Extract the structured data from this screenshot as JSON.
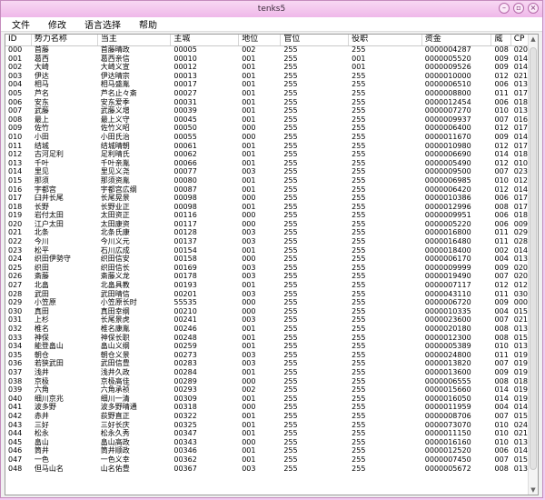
{
  "window": {
    "title": "tenks5"
  },
  "menu": [
    "文件",
    "修改",
    "语言选择",
    "帮助"
  ],
  "columns": [
    "ID",
    "势力名称",
    "当主",
    "主城",
    "地位",
    "官位",
    "役职",
    "资金",
    "威",
    "CP"
  ],
  "rows": [
    [
      "000",
      "首藤",
      "首藤晴政",
      "00005",
      "002",
      "255",
      "255",
      "0000004287",
      "008",
      "020"
    ],
    [
      "001",
      "葛西",
      "葛西亲信",
      "00010",
      "001",
      "255",
      "001",
      "0000005520",
      "009",
      "014"
    ],
    [
      "002",
      "大崎",
      "大崎义宣",
      "00012",
      "001",
      "255",
      "001",
      "0000009526",
      "009",
      "014"
    ],
    [
      "003",
      "伊达",
      "伊达晴宗",
      "00013",
      "001",
      "255",
      "255",
      "0000010000",
      "012",
      "021"
    ],
    [
      "004",
      "相马",
      "相马盛胤",
      "00017",
      "001",
      "255",
      "255",
      "0000006510",
      "006",
      "013"
    ],
    [
      "005",
      "芦名",
      "芦名止々斎",
      "00027",
      "001",
      "255",
      "255",
      "0000008800",
      "011",
      "017"
    ],
    [
      "006",
      "安东",
      "安东爱季",
      "00031",
      "001",
      "255",
      "255",
      "0000012454",
      "006",
      "018"
    ],
    [
      "007",
      "武藤",
      "武藤义增",
      "00039",
      "001",
      "255",
      "255",
      "0000007270",
      "010",
      "013"
    ],
    [
      "008",
      "最上",
      "最上义守",
      "00045",
      "001",
      "255",
      "255",
      "0000009937",
      "007",
      "016"
    ],
    [
      "009",
      "佐竹",
      "佐竹义昭",
      "00050",
      "000",
      "255",
      "255",
      "0000006400",
      "012",
      "017"
    ],
    [
      "010",
      "小田",
      "小田氏治",
      "00055",
      "000",
      "255",
      "255",
      "0000011670",
      "009",
      "014"
    ],
    [
      "011",
      "结城",
      "结城晴朝",
      "00061",
      "001",
      "255",
      "255",
      "0000010980",
      "012",
      "017"
    ],
    [
      "012",
      "古河足利",
      "足利晴氏",
      "00062",
      "001",
      "255",
      "255",
      "0000006690",
      "014",
      "018"
    ],
    [
      "013",
      "千叶",
      "千叶亲胤",
      "00066",
      "001",
      "255",
      "255",
      "0000005490",
      "012",
      "010"
    ],
    [
      "014",
      "里见",
      "里见义尧",
      "00077",
      "003",
      "255",
      "255",
      "0000009500",
      "007",
      "023"
    ],
    [
      "015",
      "那须",
      "那须资胤",
      "00080",
      "001",
      "255",
      "255",
      "0000006985",
      "010",
      "012"
    ],
    [
      "016",
      "宇都宫",
      "宇都宫広纲",
      "00087",
      "001",
      "255",
      "255",
      "0000006420",
      "012",
      "014"
    ],
    [
      "017",
      "臼井长尾",
      "长尾晃景",
      "00098",
      "000",
      "255",
      "255",
      "0000010386",
      "006",
      "017"
    ],
    [
      "018",
      "长野",
      "长野业正",
      "00098",
      "001",
      "255",
      "255",
      "0000012996",
      "008",
      "017"
    ],
    [
      "019",
      "岩付太田",
      "太田资正",
      "00116",
      "000",
      "255",
      "255",
      "0000009951",
      "006",
      "018"
    ],
    [
      "020",
      "江户太田",
      "太田康资",
      "00117",
      "000",
      "255",
      "255",
      "0000005220",
      "006",
      "009"
    ],
    [
      "021",
      "北条",
      "北条氏康",
      "00128",
      "003",
      "255",
      "255",
      "0000016800",
      "011",
      "029"
    ],
    [
      "022",
      "今川",
      "今川义元",
      "00137",
      "003",
      "255",
      "255",
      "0000016480",
      "011",
      "028"
    ],
    [
      "023",
      "松平",
      "石川広成",
      "00154",
      "001",
      "255",
      "255",
      "0000018400",
      "002",
      "014"
    ],
    [
      "024",
      "织田伊勢守",
      "织田信安",
      "00158",
      "000",
      "255",
      "255",
      "0000006170",
      "004",
      "013"
    ],
    [
      "025",
      "织田",
      "织田信长",
      "00169",
      "003",
      "255",
      "255",
      "0000009999",
      "009",
      "020"
    ],
    [
      "026",
      "斎藤",
      "斎藤义龙",
      "00178",
      "003",
      "255",
      "255",
      "0000019490",
      "007",
      "020"
    ],
    [
      "027",
      "北畠",
      "北畠具教",
      "00193",
      "001",
      "255",
      "255",
      "0000007117",
      "012",
      "012"
    ],
    [
      "028",
      "武田",
      "武田晴信",
      "00201",
      "003",
      "255",
      "255",
      "0000043110",
      "011",
      "030"
    ],
    [
      "029",
      "小笠原",
      "小笠原长时",
      "55535",
      "000",
      "255",
      "255",
      "0000006720",
      "009",
      "000"
    ],
    [
      "030",
      "真田",
      "真田幸纲",
      "00210",
      "000",
      "255",
      "255",
      "0000010335",
      "004",
      "015"
    ],
    [
      "031",
      "上杉",
      "长尾景虎",
      "00241",
      "003",
      "255",
      "255",
      "0000023600",
      "007",
      "021"
    ],
    [
      "032",
      "椎名",
      "椎名康胤",
      "00246",
      "001",
      "255",
      "255",
      "0000020180",
      "008",
      "013"
    ],
    [
      "033",
      "神保",
      "神保长职",
      "00248",
      "001",
      "255",
      "255",
      "0000012300",
      "008",
      "015"
    ],
    [
      "034",
      "能登畠山",
      "畠山义纲",
      "00259",
      "001",
      "255",
      "255",
      "0000005389",
      "010",
      "013"
    ],
    [
      "035",
      "朝仓",
      "朝仓义景",
      "00273",
      "003",
      "255",
      "255",
      "0000024800",
      "011",
      "019"
    ],
    [
      "036",
      "若狭武田",
      "武田信豊",
      "00283",
      "003",
      "255",
      "255",
      "0000013820",
      "007",
      "019"
    ],
    [
      "037",
      "浅井",
      "浅井久政",
      "00284",
      "001",
      "255",
      "255",
      "0000013600",
      "009",
      "019"
    ],
    [
      "038",
      "京极",
      "京极高佳",
      "00289",
      "000",
      "255",
      "255",
      "0000006555",
      "008",
      "018"
    ],
    [
      "039",
      "六角",
      "六角承祯",
      "00293",
      "002",
      "255",
      "255",
      "0000015660",
      "014",
      "019"
    ],
    [
      "040",
      "细川京兆",
      "细川一清",
      "00309",
      "001",
      "255",
      "255",
      "0000016050",
      "014",
      "019"
    ],
    [
      "041",
      "波多野",
      "波多野晴通",
      "00318",
      "000",
      "255",
      "255",
      "0000011959",
      "004",
      "014"
    ],
    [
      "042",
      "赤井",
      "荻野直正",
      "00322",
      "001",
      "255",
      "255",
      "0000008706",
      "007",
      "015"
    ],
    [
      "043",
      "三好",
      "三好长庆",
      "00325",
      "001",
      "255",
      "255",
      "0000073070",
      "010",
      "024"
    ],
    [
      "044",
      "松永",
      "松永久秀",
      "00347",
      "001",
      "255",
      "255",
      "0000011150",
      "010",
      "021"
    ],
    [
      "045",
      "畠山",
      "畠山高政",
      "00343",
      "000",
      "255",
      "255",
      "0000016160",
      "010",
      "013"
    ],
    [
      "046",
      "筒井",
      "筒井顺政",
      "00346",
      "001",
      "255",
      "255",
      "0000012520",
      "006",
      "014"
    ],
    [
      "047",
      "一色",
      "一色义幸",
      "00362",
      "001",
      "255",
      "255",
      "0000007450",
      "007",
      "015"
    ],
    [
      "048",
      "但马山名",
      "山名佑豊",
      "00367",
      "003",
      "255",
      "255",
      "0000005672",
      "008",
      "013"
    ]
  ]
}
